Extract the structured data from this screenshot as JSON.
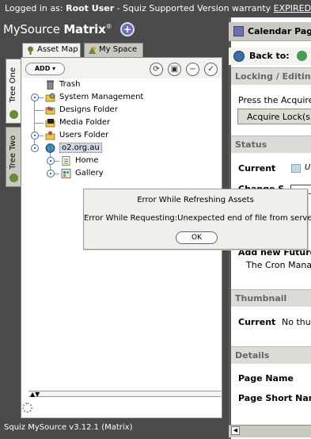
{
  "topbar": {
    "logged_in_prefix": "Logged in as:",
    "user": "Root User",
    "warranty_text": "- Squiz Supported Version warranty",
    "warranty_status": "EXPIRED"
  },
  "brand": {
    "name_light": "MySource",
    "name_bold": "Matrix",
    "mark": "®"
  },
  "tabs": {
    "asset_map": "Asset Map",
    "my_space": "My Space"
  },
  "side_tabs": {
    "tree_one": "Tree One",
    "tree_two": "Tree Two"
  },
  "toolbar": {
    "add_label": "ADD ▾",
    "refresh_icon": "⟳",
    "preview_icon": "▣",
    "collapse_icon": "−",
    "ok_icon": "✓"
  },
  "tree": {
    "items": [
      {
        "label": "Trash",
        "icon": "trash-icon"
      },
      {
        "label": "System Management",
        "icon": "system-management-icon"
      },
      {
        "label": "Designs Folder",
        "icon": "designs-folder-icon"
      },
      {
        "label": "Media Folder",
        "icon": "media-folder-icon"
      },
      {
        "label": "Users Folder",
        "icon": "users-folder-icon"
      },
      {
        "label": "o2.org.au",
        "icon": "site-icon",
        "selected": true
      },
      {
        "label": "Home",
        "icon": "page-icon"
      },
      {
        "label": "Gallery",
        "icon": "gallery-icon"
      }
    ],
    "scroll_arrows": "▲▼"
  },
  "version": "Squiz MySource v3.12.1 (Matrix)",
  "right_panel": {
    "title": "Calendar Page",
    "back_label": "Back to:",
    "locking_header": "Locking / Editing",
    "press_text": "Press the Acquire L",
    "acquire_button": "Acquire Lock(s)",
    "status_header": "Status",
    "current_label": "Current",
    "status_value": "U",
    "change_label": "Change S",
    "future_label": "Add new Future S",
    "cron_text": "The Cron Manage",
    "thumbnail_header": "Thumbnail",
    "thumb_current_label": "Current",
    "thumb_value": "No thum",
    "details_header": "Details",
    "page_name_label": "Page Name",
    "page_short_name_label": "Page Short Name"
  },
  "dialog": {
    "title": "Error While Refreshing Assets",
    "message": "Error While Requesting:Unexpected end of file from server",
    "ok_label": "OK"
  },
  "colors": {
    "chrome_dark": "#4a4a4a",
    "tab_active": "#f2f2ef",
    "tab_inactive": "#c9c9c2",
    "section_header": "#dcdcd6",
    "selected_node": "#cfd9e6",
    "tree_connector": "#6f9bd0"
  }
}
